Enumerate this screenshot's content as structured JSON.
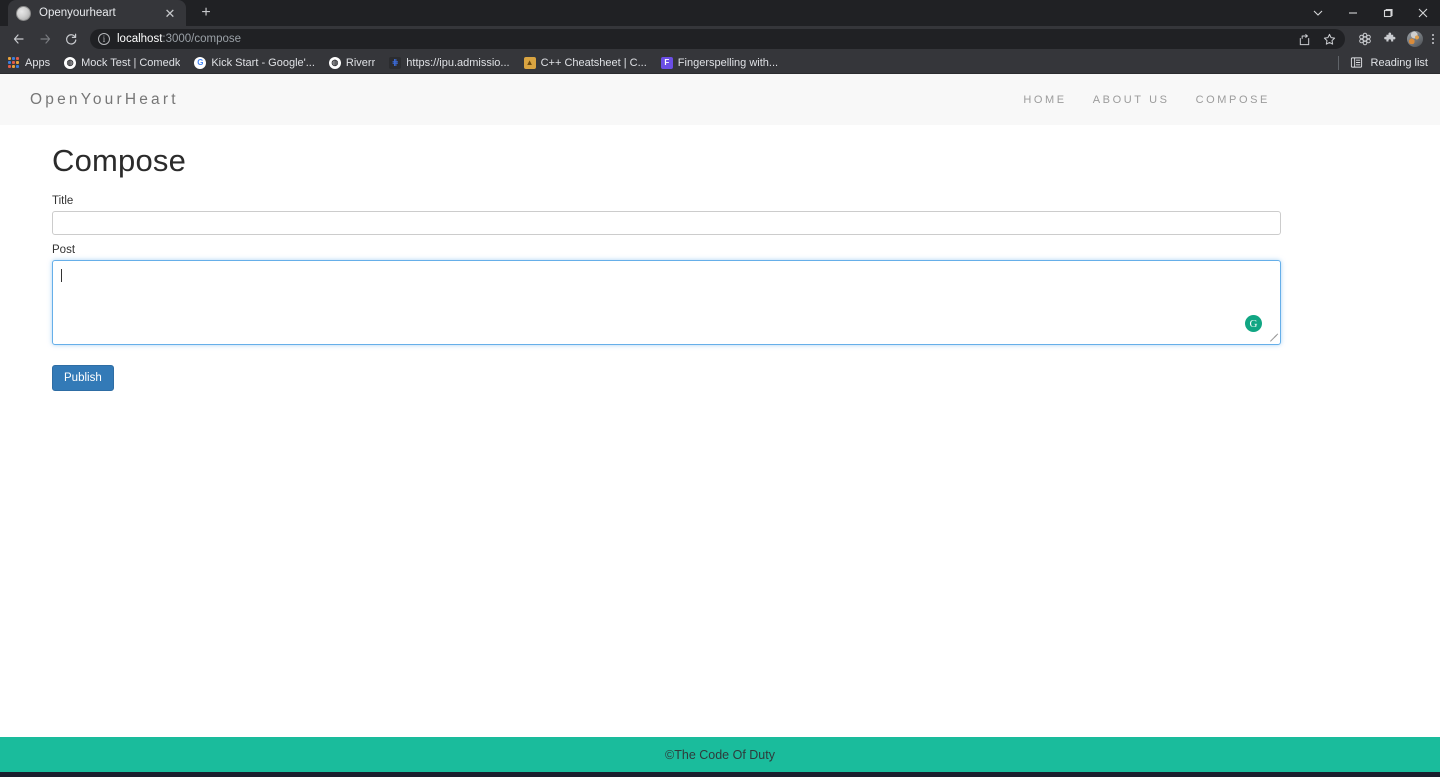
{
  "browser": {
    "tab": {
      "title": "Openyourheart",
      "favicon": "globe-icon",
      "close": "✕"
    },
    "new_tab": "+",
    "window_controls": {
      "minimize": "−",
      "maximize": "□",
      "close": "✕",
      "list": "⌄"
    },
    "navigation": {
      "back": "←",
      "forward": "→",
      "reload": "⟳"
    },
    "address": {
      "info_icon": "ⓘ",
      "host": "localhost",
      "path": ":3000/compose",
      "full": "localhost:3000/compose"
    },
    "omnibox_actions": [
      "share-icon",
      "star-icon"
    ],
    "toolbar_actions": [
      "settings-icon",
      "extensions-icon",
      "profile-avatar",
      "menu-icon"
    ],
    "bookmarks": [
      {
        "label": "Apps",
        "icon": "apps-grid-icon",
        "color": "#f0a03c"
      },
      {
        "label": "Mock Test | Comedk",
        "icon": "globe-icon",
        "color": "#ffffff"
      },
      {
        "label": "Kick Start - Google'...",
        "icon": "google-icon",
        "color": "#4285f4"
      },
      {
        "label": "Riverr",
        "icon": "globe-icon",
        "color": "#ffffff"
      },
      {
        "label": "https://ipu.admissio...",
        "icon": "ipu-icon",
        "color": "#3b6ad8"
      },
      {
        "label": "C++ Cheatsheet | C...",
        "icon": "cpp-icon",
        "color": "#d9a441"
      },
      {
        "label": "Fingerspelling with...",
        "icon": "f-icon",
        "color": "#6b4ee6"
      }
    ],
    "reading_list": {
      "label": "Reading list",
      "icon": "reading-list-icon"
    }
  },
  "site": {
    "brand": "OpenYourHeart",
    "nav": [
      {
        "label": "HOME"
      },
      {
        "label": "ABOUT US"
      },
      {
        "label": "COMPOSE"
      }
    ]
  },
  "main": {
    "heading": "Compose",
    "title_field": {
      "label": "Title",
      "value": "",
      "placeholder": ""
    },
    "post_field": {
      "label": "Post",
      "value": "",
      "placeholder": ""
    },
    "grammarly_badge": "G",
    "publish_button": "Publish"
  },
  "footer": {
    "text": "©The Code Of Duty"
  },
  "colors": {
    "accent_teal": "#1abc9c",
    "button_blue": "#337ab7",
    "focus_blue": "#66afe9",
    "chrome_dark": "#35363a",
    "grammarly_green": "#11a683"
  }
}
